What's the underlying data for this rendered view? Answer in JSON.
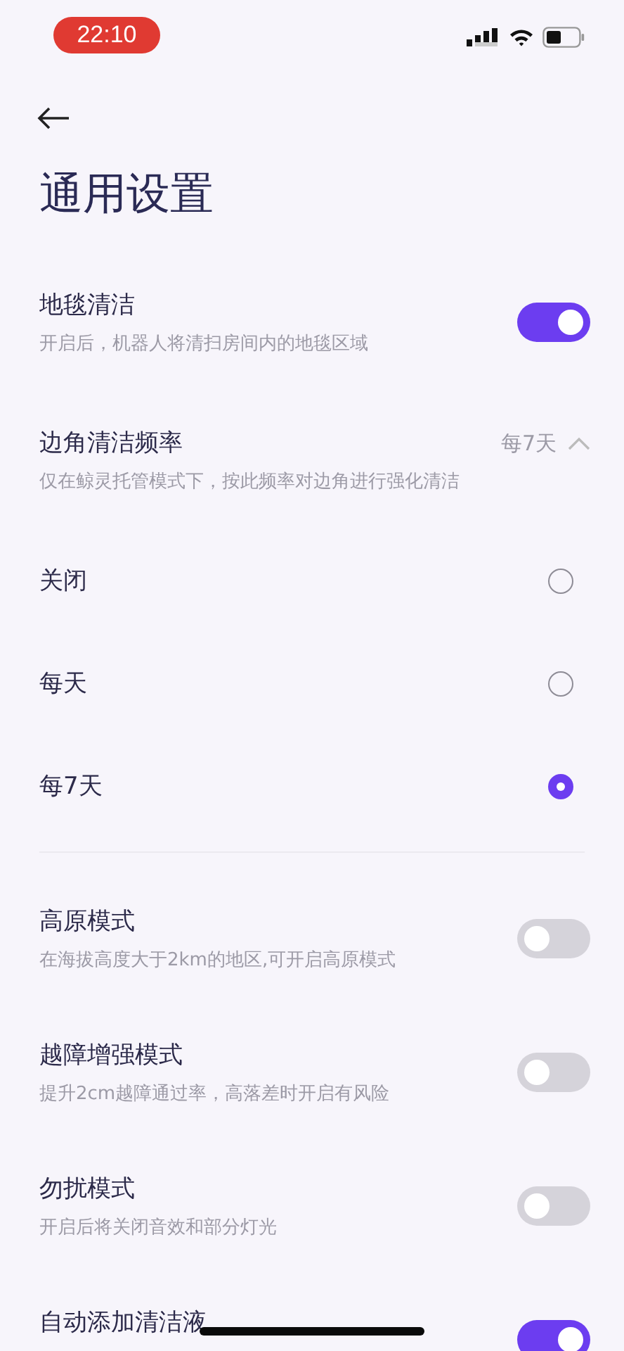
{
  "status_bar": {
    "time": "22:10"
  },
  "header": {
    "title": "通用设置"
  },
  "groups": [
    {
      "items": [
        {
          "kind": "toggle",
          "title": "地毯清洁",
          "description": "开启后，机器人将清扫房间内的地毯区域",
          "on": true
        },
        {
          "kind": "select",
          "title": "边角清洁频率",
          "description": "仅在鲸灵托管模式下，按此频率对边角进行强化清洁",
          "value": "每7天",
          "expanded": true,
          "options": [
            {
              "label": "关闭",
              "selected": false
            },
            {
              "label": "每天",
              "selected": false
            },
            {
              "label": "每7天",
              "selected": true
            }
          ]
        }
      ]
    },
    {
      "items": [
        {
          "kind": "toggle",
          "title": "高原模式",
          "description": "在海拔高度大于2km的地区,可开启高原模式",
          "on": false
        },
        {
          "kind": "toggle",
          "title": "越障增强模式",
          "description": "提升2cm越障通过率，高落差时开启有风险",
          "on": false
        },
        {
          "kind": "toggle",
          "title": "勿扰模式",
          "description": "开启后将关闭音效和部分灯光",
          "on": false
        },
        {
          "kind": "toggle",
          "title": "自动添加清洁液",
          "on": true
        }
      ]
    }
  ]
}
